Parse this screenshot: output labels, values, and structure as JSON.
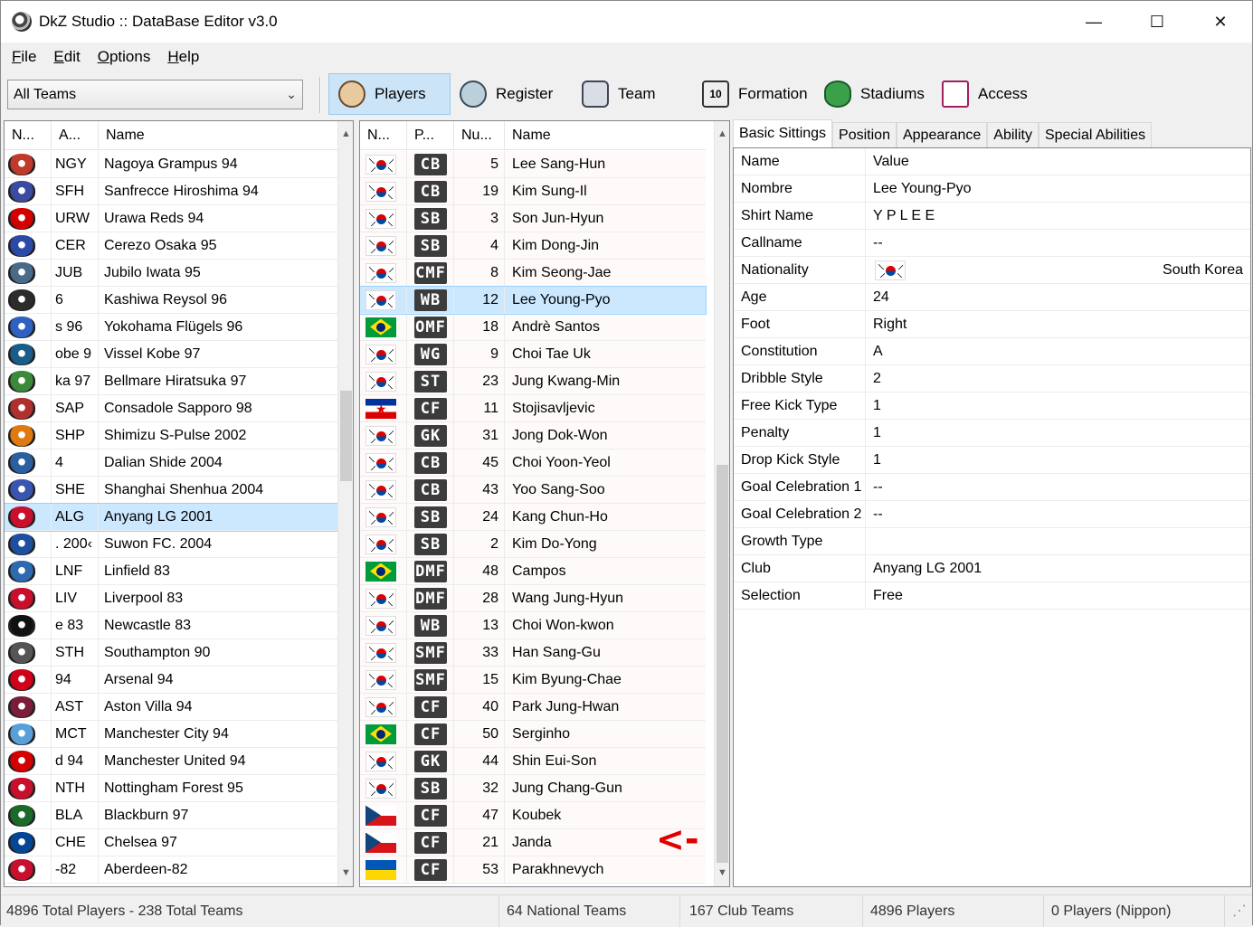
{
  "window": {
    "title": "DkZ Studio :: DataBase Editor v3.0"
  },
  "menu": [
    {
      "u": "F",
      "rest": "ile"
    },
    {
      "u": "E",
      "rest": "dit"
    },
    {
      "u": "O",
      "rest": "ptions"
    },
    {
      "u": "H",
      "rest": "elp"
    }
  ],
  "toolbar": {
    "team_filter": "All Teams",
    "buttons": [
      "Players",
      "Register",
      "Team",
      "Formation",
      "Stadiums",
      "Access"
    ]
  },
  "teams": {
    "headers": [
      "N...",
      "A...",
      "Name"
    ],
    "rows": [
      {
        "abbr": "NGY",
        "name": "Nagoya Grampus 94",
        "color": "#c0392b"
      },
      {
        "abbr": "SFH",
        "name": "Sanfrecce Hiroshima 94",
        "color": "#3b4ba0"
      },
      {
        "abbr": "URW",
        "name": "Urawa Reds 94",
        "color": "#d40000"
      },
      {
        "abbr": "CER",
        "name": "Cerezo Osaka 95",
        "color": "#2b4aa8"
      },
      {
        "abbr": "JUB",
        "name": "Jubilo Iwata 95",
        "color": "#4a6a8a"
      },
      {
        "abbr": "6",
        "name": "Kashiwa Reysol 96",
        "color": "#2c2c2c"
      },
      {
        "abbr": "s 96",
        "name": "Yokohama Flügels 96",
        "color": "#3060c0"
      },
      {
        "abbr": "obe 9",
        "name": "Vissel Kobe 97",
        "color": "#1a5c8a"
      },
      {
        "abbr": "ka 97",
        "name": "Bellmare Hiratsuka 97",
        "color": "#3a8a3a"
      },
      {
        "abbr": "SAP",
        "name": "Consadole Sapporo 98",
        "color": "#b03030"
      },
      {
        "abbr": "SHP",
        "name": "Shimizu S-Pulse 2002",
        "color": "#e07a10"
      },
      {
        "abbr": "4",
        "name": "Dalian Shide 2004",
        "color": "#2a5fa0"
      },
      {
        "abbr": "SHE",
        "name": "Shanghai Shenhua 2004",
        "color": "#3a55b0"
      },
      {
        "abbr": "ALG",
        "name": "Anyang LG 2001",
        "color": "#c8102e"
      },
      {
        "abbr": ". 200‹",
        "name": "Suwon FC. 2004",
        "color": "#1e4fa0"
      },
      {
        "abbr": "LNF",
        "name": "Linfield 83",
        "color": "#2d6ab0"
      },
      {
        "abbr": "LIV",
        "name": "Liverpool 83",
        "color": "#c8102e"
      },
      {
        "abbr": "e 83",
        "name": "Newcastle 83",
        "color": "#111111"
      },
      {
        "abbr": "STH",
        "name": "Southampton 90",
        "color": "#555555"
      },
      {
        "abbr": "94",
        "name": "Arsenal 94",
        "color": "#d0021b"
      },
      {
        "abbr": "AST",
        "name": "Aston Villa 94",
        "color": "#7a1c3a"
      },
      {
        "abbr": "MCT",
        "name": "Manchester City 94",
        "color": "#5aa0d8"
      },
      {
        "abbr": "d 94",
        "name": "Manchester United 94",
        "color": "#d40000"
      },
      {
        "abbr": "NTH",
        "name": "Nottingham Forest 95",
        "color": "#c8102e"
      },
      {
        "abbr": "BLA",
        "name": "Blackburn 97",
        "color": "#1a6a2a"
      },
      {
        "abbr": "CHE",
        "name": "Chelsea 97",
        "color": "#034694"
      },
      {
        "abbr": "-82",
        "name": "Aberdeen-82",
        "color": "#c8102e"
      }
    ],
    "selected_index": 13
  },
  "players": {
    "headers": [
      "N...",
      "P...",
      "Nu...",
      "Name"
    ],
    "rows": [
      {
        "flag": "kor",
        "pos": "CB",
        "num": "5",
        "name": "Lee Sang-Hun"
      },
      {
        "flag": "kor",
        "pos": "CB",
        "num": "19",
        "name": "Kim Sung-Il"
      },
      {
        "flag": "kor",
        "pos": "SB",
        "num": "3",
        "name": "Son Jun-Hyun"
      },
      {
        "flag": "kor",
        "pos": "SB",
        "num": "4",
        "name": "Kim Dong-Jin"
      },
      {
        "flag": "kor",
        "pos": "CMF",
        "num": "8",
        "name": "Kim Seong-Jae"
      },
      {
        "flag": "kor",
        "pos": "WB",
        "num": "12",
        "name": "Lee Young-Pyo"
      },
      {
        "flag": "bra",
        "pos": "OMF",
        "num": "18",
        "name": "Andrè Santos"
      },
      {
        "flag": "kor",
        "pos": "WG",
        "num": "9",
        "name": "Choi Tae Uk"
      },
      {
        "flag": "kor",
        "pos": "ST",
        "num": "23",
        "name": "Jung Kwang-Min"
      },
      {
        "flag": "yug",
        "pos": "CF",
        "num": "11",
        "name": "Stojisavljevic"
      },
      {
        "flag": "kor",
        "pos": "GK",
        "num": "31",
        "name": "Jong Dok-Won"
      },
      {
        "flag": "kor",
        "pos": "CB",
        "num": "45",
        "name": "Choi Yoon-Yeol"
      },
      {
        "flag": "kor",
        "pos": "CB",
        "num": "43",
        "name": "Yoo Sang-Soo"
      },
      {
        "flag": "kor",
        "pos": "SB",
        "num": "24",
        "name": "Kang Chun-Ho"
      },
      {
        "flag": "kor",
        "pos": "SB",
        "num": "2",
        "name": "Kim Do-Yong"
      },
      {
        "flag": "bra",
        "pos": "DMF",
        "num": "48",
        "name": "Campos"
      },
      {
        "flag": "kor",
        "pos": "DMF",
        "num": "28",
        "name": "Wang Jung-Hyun"
      },
      {
        "flag": "kor",
        "pos": "WB",
        "num": "13",
        "name": "Choi Won-kwon"
      },
      {
        "flag": "kor",
        "pos": "SMF",
        "num": "33",
        "name": "Han Sang-Gu"
      },
      {
        "flag": "kor",
        "pos": "SMF",
        "num": "15",
        "name": "Kim Byung-Chae"
      },
      {
        "flag": "kor",
        "pos": "CF",
        "num": "40",
        "name": "Park Jung-Hwan"
      },
      {
        "flag": "bra",
        "pos": "CF",
        "num": "50",
        "name": "Serginho"
      },
      {
        "flag": "kor",
        "pos": "GK",
        "num": "44",
        "name": "Shin Eui-Son"
      },
      {
        "flag": "kor",
        "pos": "SB",
        "num": "32",
        "name": "Jung Chang-Gun"
      },
      {
        "flag": "cze",
        "pos": "CF",
        "num": "47",
        "name": "Koubek"
      },
      {
        "flag": "cze",
        "pos": "CF",
        "num": "21",
        "name": "Janda"
      },
      {
        "flag": "ukr",
        "pos": "CF",
        "num": "53",
        "name": "Parakhnevych"
      }
    ],
    "selected_index": 5,
    "annotation": "<-"
  },
  "details": {
    "tabs": [
      "Basic Sittings",
      "Position",
      "Appearance",
      "Ability",
      "Special Abilities"
    ],
    "header": {
      "key": "Name",
      "value": "Value"
    },
    "rows": [
      {
        "key": "Nombre",
        "value": "Lee Young-Pyo"
      },
      {
        "key": "Shirt Name",
        "value": "Y  P  L E E"
      },
      {
        "key": "Callname",
        "value": "--"
      },
      {
        "key": "Nationality",
        "value": "South Korea",
        "flag": "kor"
      },
      {
        "key": "Age",
        "value": "24"
      },
      {
        "key": "Foot",
        "value": "Right"
      },
      {
        "key": "Constitution",
        "value": "A"
      },
      {
        "key": "Dribble Style",
        "value": "2"
      },
      {
        "key": "Free Kick Type",
        "value": "1"
      },
      {
        "key": "Penalty",
        "value": "1"
      },
      {
        "key": "Drop Kick Style",
        "value": "1"
      },
      {
        "key": "Goal Celebration 1",
        "value": "--"
      },
      {
        "key": "Goal Celebration 2",
        "value": "--"
      },
      {
        "key": "Growth Type",
        "value": ""
      },
      {
        "key": "Club",
        "value": "Anyang LG 2001"
      },
      {
        "key": "Selection",
        "value": "Free"
      }
    ]
  },
  "status": [
    "4896 Total Players  -  238 Total Teams",
    "64 National Teams",
    "167 Club Teams",
    "4896 Players",
    "0 Players (Nippon)"
  ]
}
